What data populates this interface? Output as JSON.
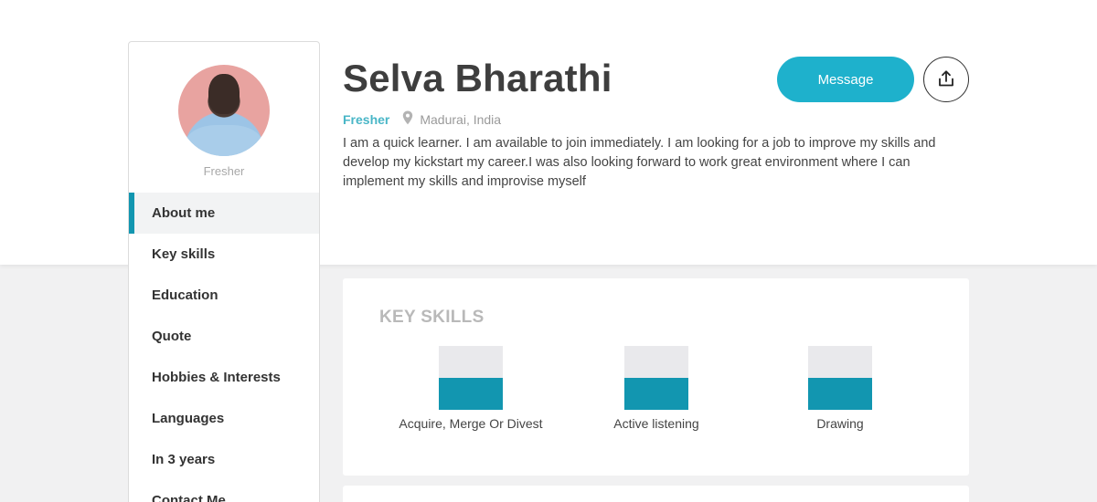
{
  "profile": {
    "name": "Selva Bharathi",
    "role": "Fresher",
    "location": "Madurai, India",
    "bio": "I am a quick learner. I am available to join immediately. I am looking for a job to improve my skills and develop my kickstart my career.I was also looking forward to work great environment where I can implement my skills and improvise myself",
    "sidebar_role": "Fresher"
  },
  "actions": {
    "message_label": "Message",
    "share_icon": "share-upload-icon"
  },
  "nav": {
    "items": [
      {
        "label": "About me",
        "active": true
      },
      {
        "label": "Key skills",
        "active": false
      },
      {
        "label": "Education",
        "active": false
      },
      {
        "label": "Quote",
        "active": false
      },
      {
        "label": "Hobbies & Interests",
        "active": false
      },
      {
        "label": "Languages",
        "active": false
      },
      {
        "label": "In 3 years",
        "active": false
      },
      {
        "label": "Contact Me",
        "active": false
      }
    ]
  },
  "key_skills": {
    "title": "KEY SKILLS",
    "skills": [
      {
        "label": "Acquire, Merge Or Divest",
        "level": 0.5
      },
      {
        "label": "Active listening",
        "level": 0.5
      },
      {
        "label": "Drawing",
        "level": 0.5
      }
    ]
  },
  "colors": {
    "accent": "#1296b0",
    "button": "#1eb1cc",
    "role": "#49b6c7"
  }
}
